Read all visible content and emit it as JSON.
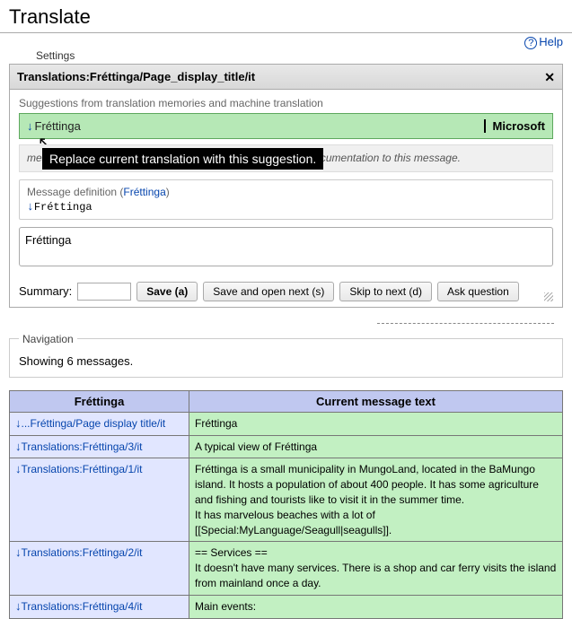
{
  "page_title": "Translate",
  "help_label": "Help",
  "settings_label": "Settings",
  "editor": {
    "header_title": "Translations:Fréttinga/Page_display_title/it",
    "suggestions_label": "Suggestions from translation memories and machine translation",
    "suggestion_text": "Fréttinga",
    "suggestion_source": "Microsoft",
    "tooltip": "Replace current translation with this suggestion.",
    "doc_text_suffix": "message is used, you can help other translators by adding documentation to this message.",
    "definition_label_prefix": "Message definition (",
    "definition_link": "Fréttinga",
    "definition_label_suffix": ")",
    "definition_value": "Fréttinga",
    "input_value": "Fréttinga",
    "summary_label": "Summary:",
    "btn_save": "Save (a)",
    "btn_save_next": "Save and open next (s)",
    "btn_skip": "Skip to next (d)",
    "btn_ask": "Ask question"
  },
  "navigation": {
    "legend": "Navigation",
    "text": "Showing 6 messages."
  },
  "table": {
    "col1": "Fréttinga",
    "col2": "Current message text",
    "rows": [
      {
        "key": "...Fréttinga/Page display title/it",
        "val": "Fréttinga"
      },
      {
        "key": "Translations:Fréttinga/3/it",
        "val": "A typical view of Fréttinga"
      },
      {
        "key": "Translations:Fréttinga/1/it",
        "val": "Fréttinga is a small municipality in MungoLand, located in the BaMungo island. It hosts a population of about 400 people.  It has some agriculture and fishing and tourists like to visit it in the summer time.\nIt has marvelous beaches with a lot of [[Special:MyLanguage/Seagull|seagulls]]."
      },
      {
        "key": "Translations:Fréttinga/2/it",
        "val": "== Services ==\nIt doesn't have many services. There is a shop and car ferry visits the island from mainland once a day."
      },
      {
        "key": "Translations:Fréttinga/4/it",
        "val": "Main events:"
      }
    ]
  }
}
